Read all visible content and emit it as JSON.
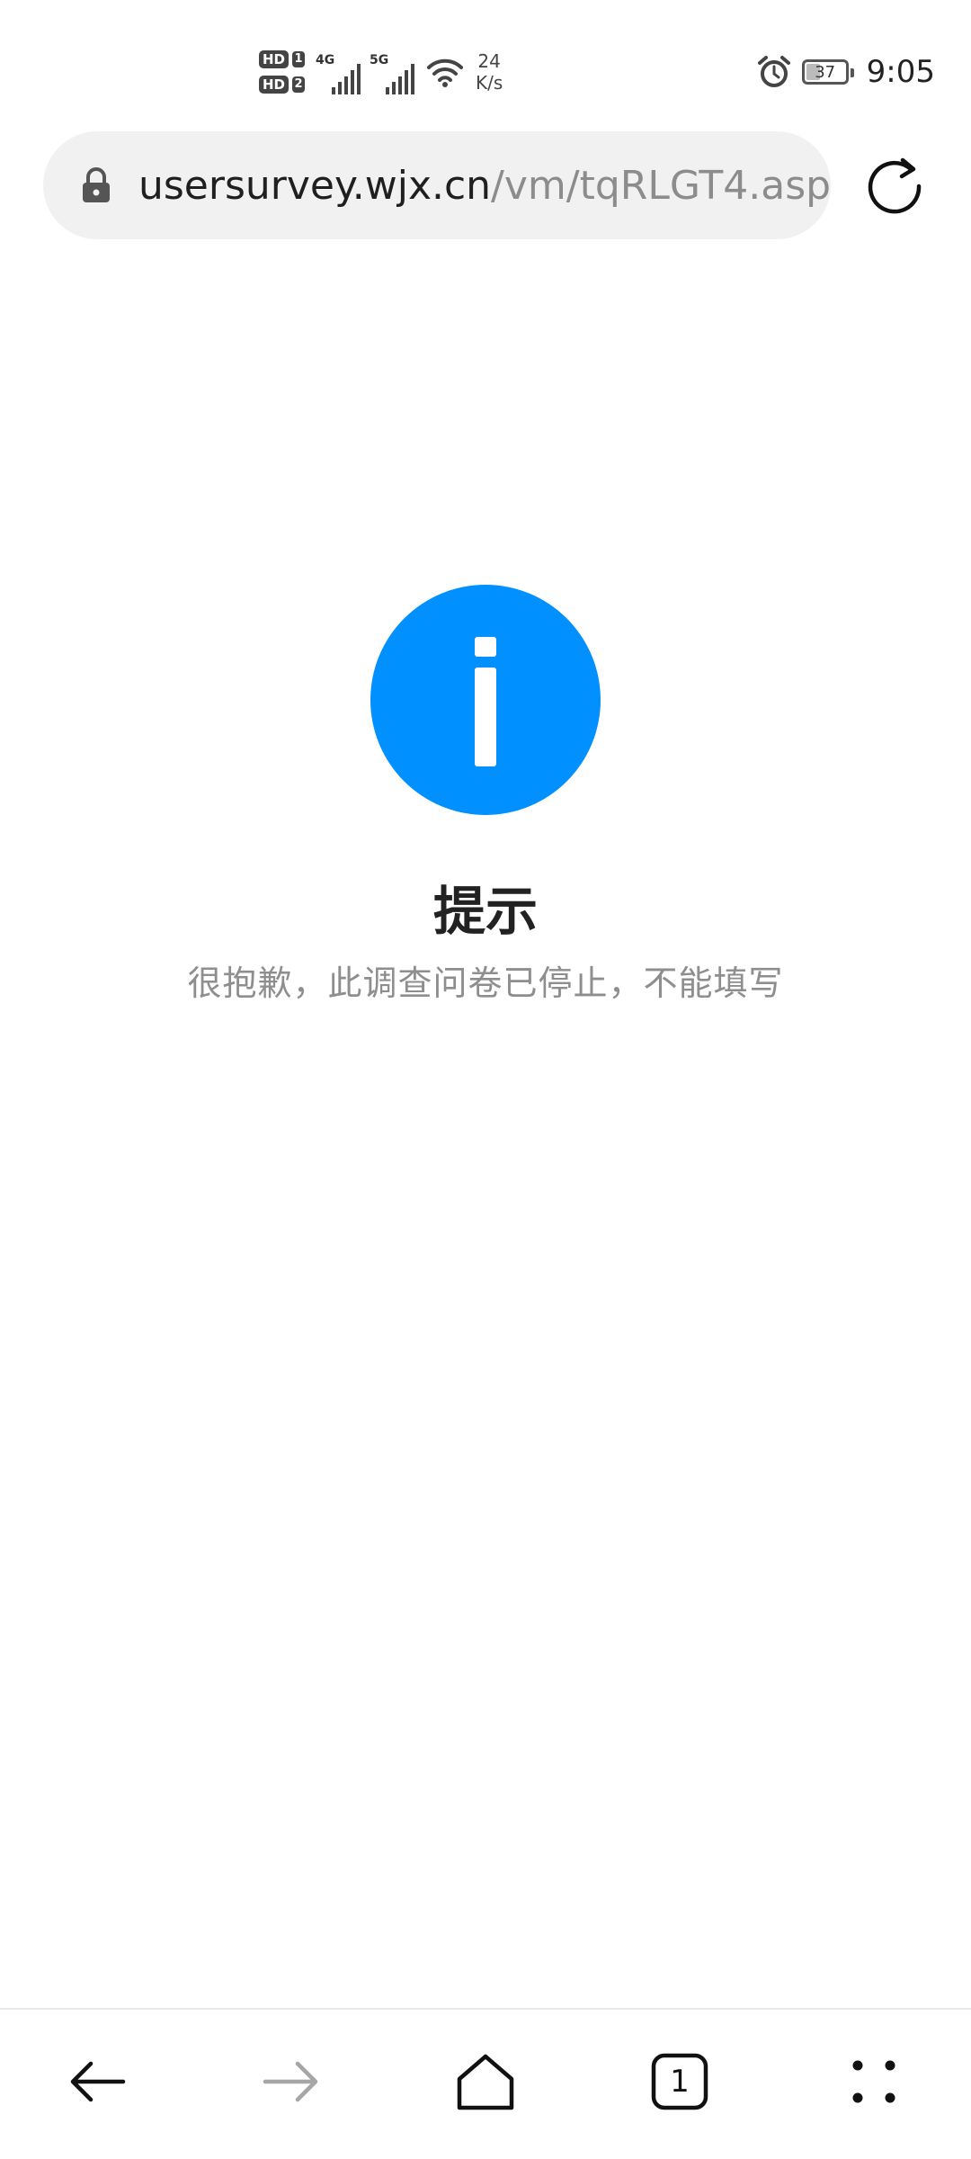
{
  "status_bar": {
    "hd1": "HD",
    "hd2": "HD",
    "sim1": "1",
    "sim2": "2",
    "net1": "4G",
    "net2": "5G",
    "speed_value": "24",
    "speed_unit": "K/s",
    "icons": [
      "alarm-icon",
      "wifi-icon",
      "signal-icon"
    ],
    "battery_percent": 37,
    "battery_label": "37",
    "time": "9:05"
  },
  "address_bar": {
    "url_domain": "usersurvey.wjx.cn",
    "url_path": "/vm/tqRLGT4.asp",
    "lock_icon": "lock-icon",
    "reload_icon": "reload-icon"
  },
  "content": {
    "icon": "info-icon",
    "accent_color": "#0090FF",
    "title": "提示",
    "message": "很抱歉，此调查问卷已停止，不能填写"
  },
  "bottom_nav": {
    "items": [
      "back-icon",
      "forward-icon",
      "home-icon",
      "tabs-icon",
      "menu-icon"
    ],
    "tab_count": "1"
  }
}
